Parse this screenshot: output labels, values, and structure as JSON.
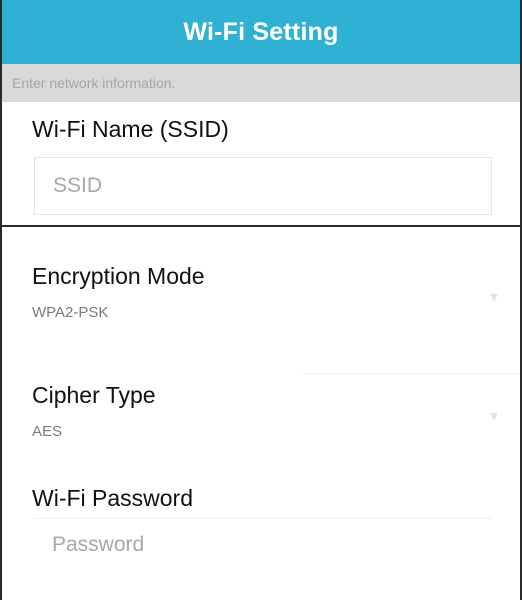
{
  "header": {
    "title": "Wi-Fi Setting"
  },
  "info": {
    "text": "Enter network information."
  },
  "ssid": {
    "label": "Wi-Fi Name (SSID)",
    "placeholder": "SSID",
    "value": ""
  },
  "encryption": {
    "label": "Encryption Mode",
    "value": "WPA2-PSK",
    "icon": "chevron-down-icon"
  },
  "cipher": {
    "label": "Cipher Type",
    "value": "AES",
    "icon": "chevron-down-icon"
  },
  "password": {
    "label": "Wi-Fi Password",
    "placeholder": "Password",
    "value": ""
  },
  "colors": {
    "accent": "#2fb1d3",
    "info_bar": "#d9d9d9",
    "text": "#111111",
    "hint": "#a8a8a8"
  }
}
